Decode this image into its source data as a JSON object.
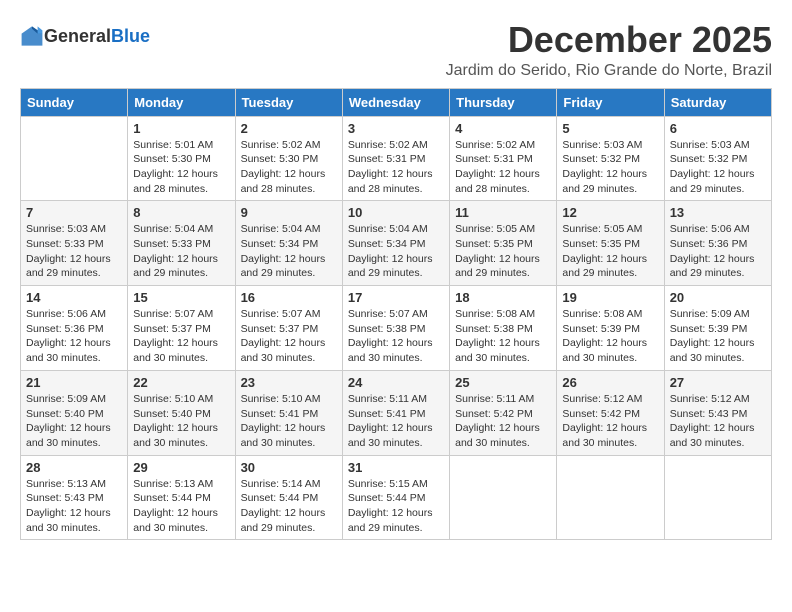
{
  "header": {
    "logo_general": "General",
    "logo_blue": "Blue",
    "month_title": "December 2025",
    "location": "Jardim do Serido, Rio Grande do Norte, Brazil"
  },
  "weekdays": [
    "Sunday",
    "Monday",
    "Tuesday",
    "Wednesday",
    "Thursday",
    "Friday",
    "Saturday"
  ],
  "weeks": [
    [
      {
        "day": "",
        "sunrise": "",
        "sunset": "",
        "daylight": ""
      },
      {
        "day": "1",
        "sunrise": "Sunrise: 5:01 AM",
        "sunset": "Sunset: 5:30 PM",
        "daylight": "Daylight: 12 hours and 28 minutes."
      },
      {
        "day": "2",
        "sunrise": "Sunrise: 5:02 AM",
        "sunset": "Sunset: 5:30 PM",
        "daylight": "Daylight: 12 hours and 28 minutes."
      },
      {
        "day": "3",
        "sunrise": "Sunrise: 5:02 AM",
        "sunset": "Sunset: 5:31 PM",
        "daylight": "Daylight: 12 hours and 28 minutes."
      },
      {
        "day": "4",
        "sunrise": "Sunrise: 5:02 AM",
        "sunset": "Sunset: 5:31 PM",
        "daylight": "Daylight: 12 hours and 28 minutes."
      },
      {
        "day": "5",
        "sunrise": "Sunrise: 5:03 AM",
        "sunset": "Sunset: 5:32 PM",
        "daylight": "Daylight: 12 hours and 29 minutes."
      },
      {
        "day": "6",
        "sunrise": "Sunrise: 5:03 AM",
        "sunset": "Sunset: 5:32 PM",
        "daylight": "Daylight: 12 hours and 29 minutes."
      }
    ],
    [
      {
        "day": "7",
        "sunrise": "Sunrise: 5:03 AM",
        "sunset": "Sunset: 5:33 PM",
        "daylight": "Daylight: 12 hours and 29 minutes."
      },
      {
        "day": "8",
        "sunrise": "Sunrise: 5:04 AM",
        "sunset": "Sunset: 5:33 PM",
        "daylight": "Daylight: 12 hours and 29 minutes."
      },
      {
        "day": "9",
        "sunrise": "Sunrise: 5:04 AM",
        "sunset": "Sunset: 5:34 PM",
        "daylight": "Daylight: 12 hours and 29 minutes."
      },
      {
        "day": "10",
        "sunrise": "Sunrise: 5:04 AM",
        "sunset": "Sunset: 5:34 PM",
        "daylight": "Daylight: 12 hours and 29 minutes."
      },
      {
        "day": "11",
        "sunrise": "Sunrise: 5:05 AM",
        "sunset": "Sunset: 5:35 PM",
        "daylight": "Daylight: 12 hours and 29 minutes."
      },
      {
        "day": "12",
        "sunrise": "Sunrise: 5:05 AM",
        "sunset": "Sunset: 5:35 PM",
        "daylight": "Daylight: 12 hours and 29 minutes."
      },
      {
        "day": "13",
        "sunrise": "Sunrise: 5:06 AM",
        "sunset": "Sunset: 5:36 PM",
        "daylight": "Daylight: 12 hours and 29 minutes."
      }
    ],
    [
      {
        "day": "14",
        "sunrise": "Sunrise: 5:06 AM",
        "sunset": "Sunset: 5:36 PM",
        "daylight": "Daylight: 12 hours and 30 minutes."
      },
      {
        "day": "15",
        "sunrise": "Sunrise: 5:07 AM",
        "sunset": "Sunset: 5:37 PM",
        "daylight": "Daylight: 12 hours and 30 minutes."
      },
      {
        "day": "16",
        "sunrise": "Sunrise: 5:07 AM",
        "sunset": "Sunset: 5:37 PM",
        "daylight": "Daylight: 12 hours and 30 minutes."
      },
      {
        "day": "17",
        "sunrise": "Sunrise: 5:07 AM",
        "sunset": "Sunset: 5:38 PM",
        "daylight": "Daylight: 12 hours and 30 minutes."
      },
      {
        "day": "18",
        "sunrise": "Sunrise: 5:08 AM",
        "sunset": "Sunset: 5:38 PM",
        "daylight": "Daylight: 12 hours and 30 minutes."
      },
      {
        "day": "19",
        "sunrise": "Sunrise: 5:08 AM",
        "sunset": "Sunset: 5:39 PM",
        "daylight": "Daylight: 12 hours and 30 minutes."
      },
      {
        "day": "20",
        "sunrise": "Sunrise: 5:09 AM",
        "sunset": "Sunset: 5:39 PM",
        "daylight": "Daylight: 12 hours and 30 minutes."
      }
    ],
    [
      {
        "day": "21",
        "sunrise": "Sunrise: 5:09 AM",
        "sunset": "Sunset: 5:40 PM",
        "daylight": "Daylight: 12 hours and 30 minutes."
      },
      {
        "day": "22",
        "sunrise": "Sunrise: 5:10 AM",
        "sunset": "Sunset: 5:40 PM",
        "daylight": "Daylight: 12 hours and 30 minutes."
      },
      {
        "day": "23",
        "sunrise": "Sunrise: 5:10 AM",
        "sunset": "Sunset: 5:41 PM",
        "daylight": "Daylight: 12 hours and 30 minutes."
      },
      {
        "day": "24",
        "sunrise": "Sunrise: 5:11 AM",
        "sunset": "Sunset: 5:41 PM",
        "daylight": "Daylight: 12 hours and 30 minutes."
      },
      {
        "day": "25",
        "sunrise": "Sunrise: 5:11 AM",
        "sunset": "Sunset: 5:42 PM",
        "daylight": "Daylight: 12 hours and 30 minutes."
      },
      {
        "day": "26",
        "sunrise": "Sunrise: 5:12 AM",
        "sunset": "Sunset: 5:42 PM",
        "daylight": "Daylight: 12 hours and 30 minutes."
      },
      {
        "day": "27",
        "sunrise": "Sunrise: 5:12 AM",
        "sunset": "Sunset: 5:43 PM",
        "daylight": "Daylight: 12 hours and 30 minutes."
      }
    ],
    [
      {
        "day": "28",
        "sunrise": "Sunrise: 5:13 AM",
        "sunset": "Sunset: 5:43 PM",
        "daylight": "Daylight: 12 hours and 30 minutes."
      },
      {
        "day": "29",
        "sunrise": "Sunrise: 5:13 AM",
        "sunset": "Sunset: 5:44 PM",
        "daylight": "Daylight: 12 hours and 30 minutes."
      },
      {
        "day": "30",
        "sunrise": "Sunrise: 5:14 AM",
        "sunset": "Sunset: 5:44 PM",
        "daylight": "Daylight: 12 hours and 29 minutes."
      },
      {
        "day": "31",
        "sunrise": "Sunrise: 5:15 AM",
        "sunset": "Sunset: 5:44 PM",
        "daylight": "Daylight: 12 hours and 29 minutes."
      },
      {
        "day": "",
        "sunrise": "",
        "sunset": "",
        "daylight": ""
      },
      {
        "day": "",
        "sunrise": "",
        "sunset": "",
        "daylight": ""
      },
      {
        "day": "",
        "sunrise": "",
        "sunset": "",
        "daylight": ""
      }
    ]
  ]
}
